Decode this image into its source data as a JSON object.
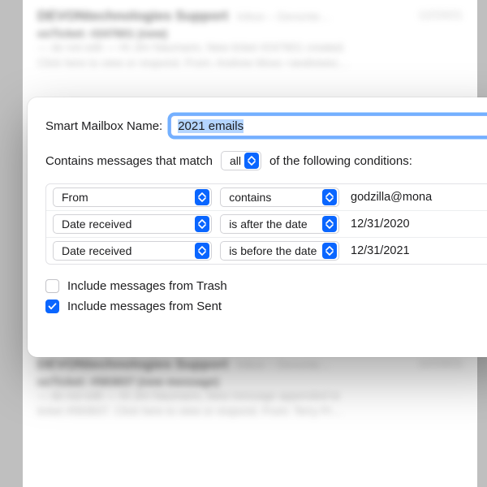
{
  "background": {
    "msg1": {
      "sender": "DEVONtechnologies Support",
      "folder": "Inbox – Devonte…",
      "date": "12/23/21",
      "subject": "osTicket: #247601 (new)",
      "preview1": "— do not edit — Hi Jim Naumann, New ticket #247601 created.",
      "preview2": "Click here to view or respond. From: Andrew Moss <andrewsc…"
    },
    "msg2": {
      "sender": "DEVONtechnologies Support",
      "folder": "Inbox – Devonte…",
      "date": "12/23/21",
      "subject": "osTicket: #583837 (new message)",
      "preview1": "— do not edit — Hi Jim Naumann, New message appended to",
      "preview2": "ticket #583837. Click here to view or respond. From: Terry Pr…"
    }
  },
  "sheet": {
    "name_label": "Smart Mailbox Name:",
    "name_value": "2021 emails",
    "contains_prefix": "Contains messages that match",
    "match_mode": "all",
    "contains_suffix": "of the following conditions:",
    "conditions": [
      {
        "field": "From",
        "op": "contains",
        "value": "godzilla@mona"
      },
      {
        "field": "Date received",
        "op": "is after the date",
        "value": "12/31/2020"
      },
      {
        "field": "Date received",
        "op": "is before the date",
        "value": "12/31/2021"
      }
    ],
    "include_trash_label": "Include messages from Trash",
    "include_trash_checked": false,
    "include_sent_label": "Include messages from Sent",
    "include_sent_checked": true
  }
}
